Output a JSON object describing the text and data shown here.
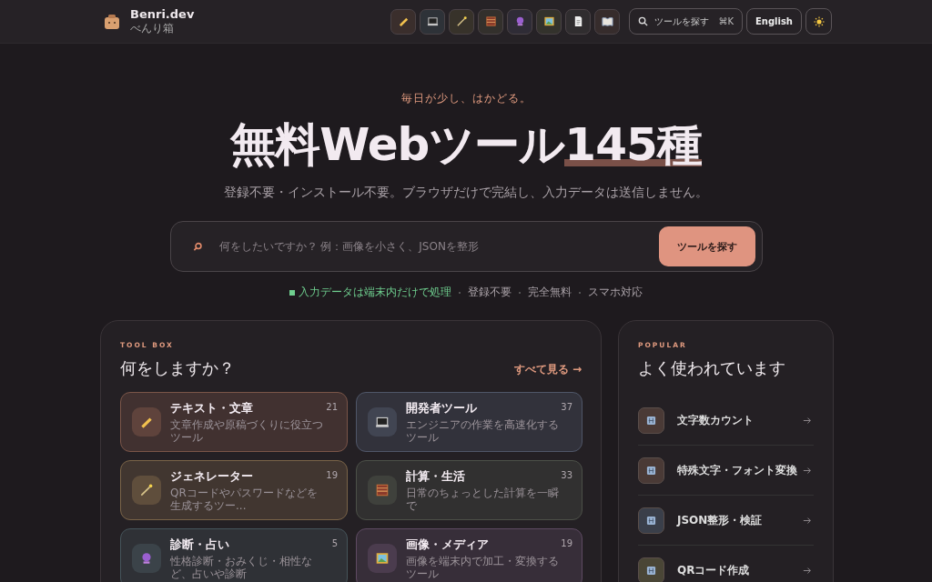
{
  "header": {
    "brand": "Benri.dev",
    "brand_sub": "べんり箱",
    "search_label": "ツールを探す",
    "shortcut": "⌘K",
    "language": "English"
  },
  "hero": {
    "tagline": "毎日が少し、はかどる。",
    "title": "無料Webツール",
    "title_highlight": "145種",
    "subtitle": "登録不要・インストール不要。ブラウザだけで完結し、入力データは送信しません。",
    "search": {
      "placeholder": "何をしたいですか？ 例：画像を小さく、JSONを整形",
      "button": "ツールを探す"
    },
    "badges": [
      {
        "label": "入力データは端末内だけで処理",
        "kind": "secure"
      },
      {
        "label": "登録不要",
        "kind": "plain"
      },
      {
        "label": "完全無料",
        "kind": "plain"
      },
      {
        "label": "スマホ対応",
        "kind": "plain"
      }
    ]
  },
  "toolbox": {
    "eyebrow": "TOOL BOX",
    "heading": "何をしますか？",
    "see_all": "すべて見る →",
    "categories": [
      {
        "name": "テキスト・文章",
        "description": "文章作成や原稿づくりに役立つツール",
        "count": "21",
        "color": "#7a5548"
      },
      {
        "name": "開発者ツール",
        "description": "エンジニアの作業を高速化するツール",
        "count": "37",
        "color": "#4f5668"
      },
      {
        "name": "ジェネレーター",
        "description": "QRコードやパスワードなどを生成するツー...",
        "count": "19",
        "color": "#7a6448"
      },
      {
        "name": "計算・生活",
        "description": "日常のちょっとした計算を一瞬で",
        "count": "33",
        "color": "#4c5048"
      },
      {
        "name": "診断・占い",
        "description": "性格診断・おみくじ・相性など、占いや診断",
        "count": "5",
        "color": "#45545a"
      },
      {
        "name": "画像・メディア",
        "description": "画像を端末内で加工・変換するツール",
        "count": "19",
        "color": "#5e4a62"
      }
    ]
  },
  "popular": {
    "eyebrow": "POPULAR",
    "heading": "よく使われています",
    "items": [
      {
        "label": "文字数カウント",
        "color": "#4a3a36"
      },
      {
        "label": "特殊文字・フォント変換",
        "color": "#4a3a36"
      },
      {
        "label": "JSON整形・検証",
        "color": "#3a3f4a"
      },
      {
        "label": "QRコード作成",
        "color": "#4a4636"
      }
    ]
  }
}
